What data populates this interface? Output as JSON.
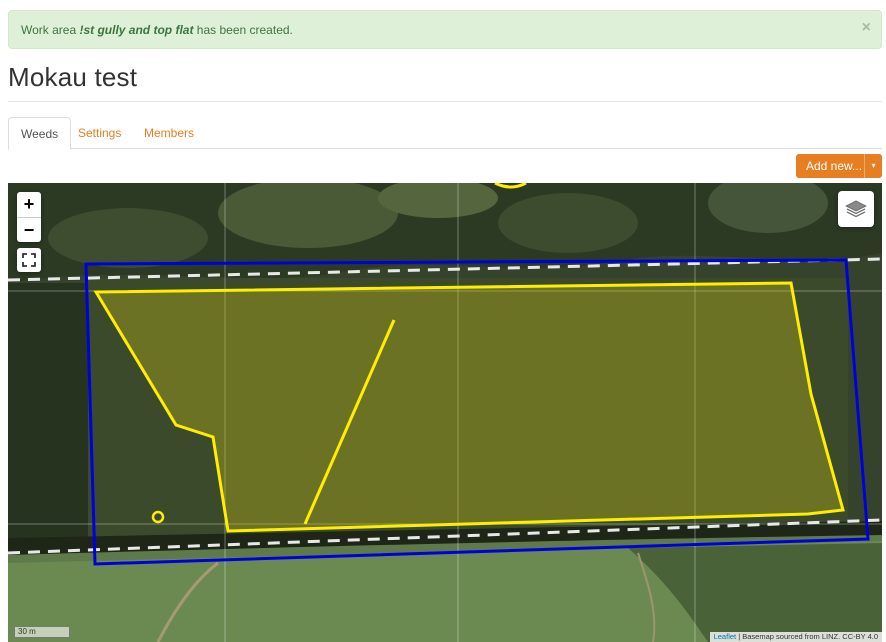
{
  "alert": {
    "prefix": "Work area ",
    "name": "!st gully and top flat",
    "suffix": " has been created.",
    "close_glyph": "×"
  },
  "page": {
    "title": "Mokau test"
  },
  "tabs": [
    {
      "label": "Weeds",
      "active": true
    },
    {
      "label": "Settings",
      "active": false
    },
    {
      "label": "Members",
      "active": false
    }
  ],
  "toolbar": {
    "add_label": "Add new...",
    "caret": "▾"
  },
  "map": {
    "zoom_in": "+",
    "zoom_out": "−",
    "scale_label": "30 m",
    "attribution_leaflet": "Leaflet",
    "attribution_sep": " | ",
    "attribution_basemap": "Basemap sourced from LINZ. CC-BY 4.0",
    "icons": [
      "zoom-in-icon",
      "zoom-out-icon",
      "fullscreen-icon",
      "layers-icon"
    ],
    "colors": {
      "work_area": "#0000dd",
      "weed_area": "#ffee00",
      "accent": "#e67e22"
    }
  }
}
